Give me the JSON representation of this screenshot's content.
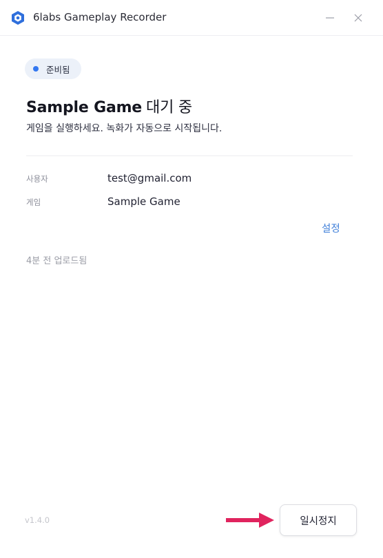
{
  "window": {
    "title": "6labs Gameplay Recorder",
    "logo_icon": "6labs-hexagon-logo-icon",
    "minimize_icon": "minimize-icon",
    "close_icon": "close-icon"
  },
  "status": {
    "label": "준비됨",
    "dot_color": "#3478f0"
  },
  "headline": {
    "game": "Sample Game",
    "suffix": "대기 중"
  },
  "subtitle": "게임을 실행하세요. 녹화가 자동으로 시작됩니다.",
  "info": {
    "user_label": "사용자",
    "user_value": "test@gmail.com",
    "game_label": "게임",
    "game_value": "Sample Game"
  },
  "settings_link": "설정",
  "upload_status": "4분 전 업로드됨",
  "footer": {
    "version": "v1.4.0",
    "pause_button": "일시정지",
    "arrow_icon": "right-arrow-icon",
    "arrow_color": "#e0245e"
  },
  "colors": {
    "accent": "#3478f0",
    "link": "#3f7fd9",
    "brand": "#2f6fdc"
  }
}
